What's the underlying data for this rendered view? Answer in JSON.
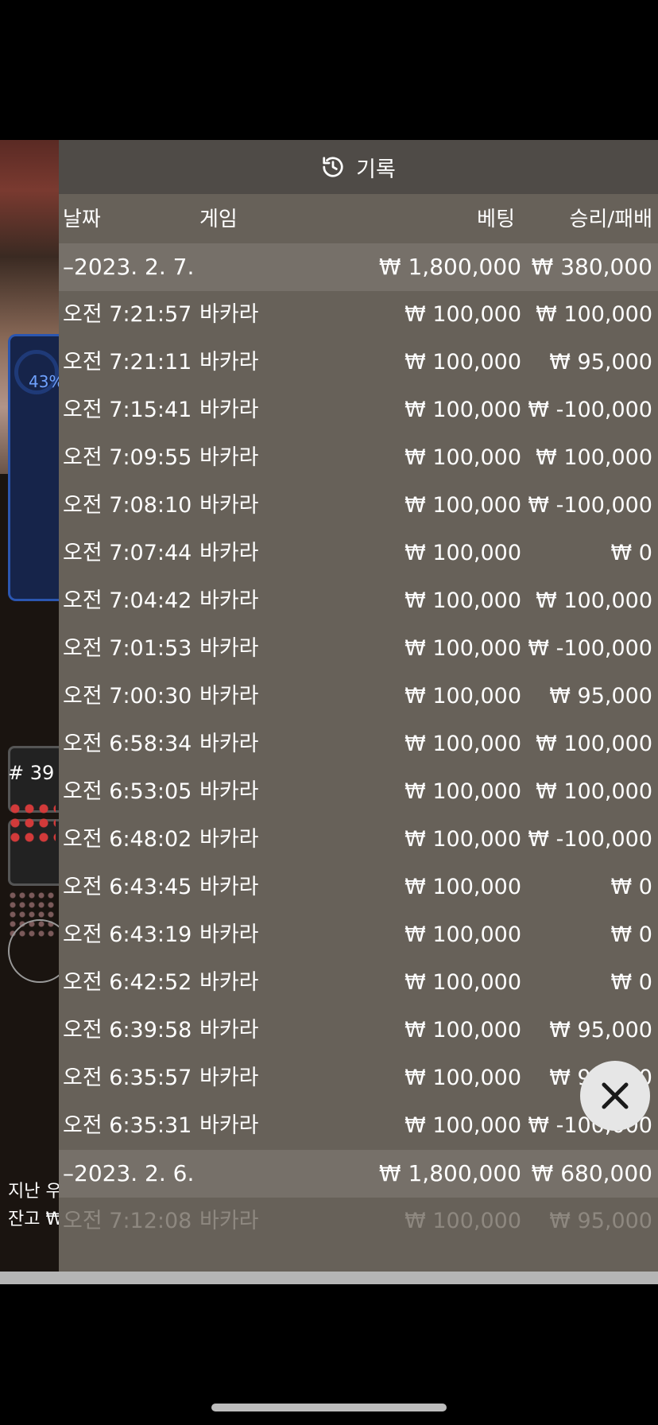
{
  "panel": {
    "title": "기록",
    "headers": {
      "date": "날짜",
      "game": "게임",
      "bet": "베팅",
      "result": "승리/패배"
    }
  },
  "days": [
    {
      "date": "–2023. 2. 7.",
      "bet_total": "₩ 1,800,000",
      "result_total": "₩ 380,000",
      "rows": [
        {
          "time": "오전 7:21:57",
          "game": "바카라",
          "bet": "₩ 100,000",
          "result": "₩ 100,000"
        },
        {
          "time": "오전 7:21:11",
          "game": "바카라",
          "bet": "₩ 100,000",
          "result": "₩ 95,000"
        },
        {
          "time": "오전 7:15:41",
          "game": "바카라",
          "bet": "₩ 100,000",
          "result": "₩ -100,000"
        },
        {
          "time": "오전 7:09:55",
          "game": "바카라",
          "bet": "₩ 100,000",
          "result": "₩ 100,000"
        },
        {
          "time": "오전 7:08:10",
          "game": "바카라",
          "bet": "₩ 100,000",
          "result": "₩ -100,000"
        },
        {
          "time": "오전 7:07:44",
          "game": "바카라",
          "bet": "₩ 100,000",
          "result": "₩ 0"
        },
        {
          "time": "오전 7:04:42",
          "game": "바카라",
          "bet": "₩ 100,000",
          "result": "₩ 100,000"
        },
        {
          "time": "오전 7:01:53",
          "game": "바카라",
          "bet": "₩ 100,000",
          "result": "₩ -100,000"
        },
        {
          "time": "오전 7:00:30",
          "game": "바카라",
          "bet": "₩ 100,000",
          "result": "₩ 95,000"
        },
        {
          "time": "오전 6:58:34",
          "game": "바카라",
          "bet": "₩ 100,000",
          "result": "₩ 100,000"
        },
        {
          "time": "오전 6:53:05",
          "game": "바카라",
          "bet": "₩ 100,000",
          "result": "₩ 100,000"
        },
        {
          "time": "오전 6:48:02",
          "game": "바카라",
          "bet": "₩ 100,000",
          "result": "₩ -100,000"
        },
        {
          "time": "오전 6:43:45",
          "game": "바카라",
          "bet": "₩ 100,000",
          "result": "₩ 0"
        },
        {
          "time": "오전 6:43:19",
          "game": "바카라",
          "bet": "₩ 100,000",
          "result": "₩ 0"
        },
        {
          "time": "오전 6:42:52",
          "game": "바카라",
          "bet": "₩ 100,000",
          "result": "₩ 0"
        },
        {
          "time": "오전 6:39:58",
          "game": "바카라",
          "bet": "₩ 100,000",
          "result": "₩ 95,000"
        },
        {
          "time": "오전 6:35:57",
          "game": "바카라",
          "bet": "₩ 100,000",
          "result": "₩ 95,000"
        },
        {
          "time": "오전 6:35:31",
          "game": "바카라",
          "bet": "₩ 100,000",
          "result": "₩ -100,000"
        }
      ]
    },
    {
      "date": "–2023. 2. 6.",
      "bet_total": "₩ 1,800,000",
      "result_total": "₩ 680,000",
      "rows": [
        {
          "time": "오전 7:12:08",
          "game": "바카라",
          "bet": "₩ 100,000",
          "result": "₩ 95,000"
        }
      ]
    }
  ],
  "background": {
    "stat_pct": "43%",
    "round": "# 39",
    "last_label": "지난 우",
    "balance_label": "잔고 ₩"
  },
  "colors": {
    "panel_bg": "#676159",
    "header_bg": "#4f4b47",
    "day_row_bg": "#767069",
    "stat_blue": "#2b56b0"
  }
}
